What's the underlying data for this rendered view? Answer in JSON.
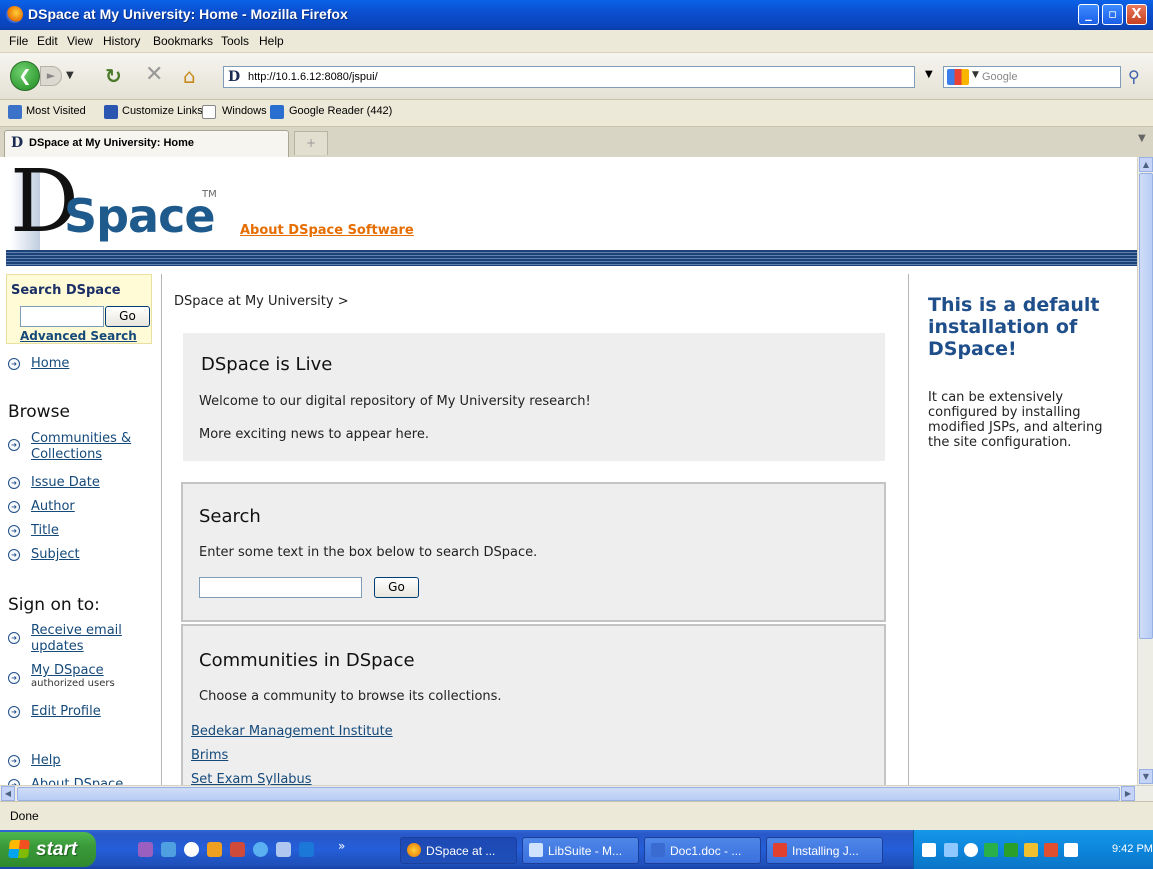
{
  "window": {
    "title": "DSpace at My University: Home - Mozilla Firefox",
    "minimize": "_",
    "maximize": "▫",
    "close": "X"
  },
  "menu": [
    "File",
    "Edit",
    "View",
    "History",
    "Bookmarks",
    "Tools",
    "Help"
  ],
  "nav": {
    "url": "http://10.1.6.12:8080/jspui/",
    "search_engine": "Google"
  },
  "bookmarks": [
    "Most Visited",
    "Customize Links",
    "Windows",
    "Google Reader (442)"
  ],
  "tab": {
    "title": "DSpace at My University: Home"
  },
  "page": {
    "logo_letter": "D",
    "logo_word": "Space",
    "logo_tm": "TM",
    "about_link": "About DSpace Software",
    "left": {
      "search_title": "Search DSpace",
      "go": "Go",
      "advanced": "Advanced Search",
      "home": "Home",
      "browse_heading": "Browse",
      "browse": [
        "Communities & Collections",
        "Issue Date",
        "Author",
        "Title",
        "Subject"
      ],
      "signon_heading": "Sign on to:",
      "receive": "Receive email updates",
      "mydspace": "My DSpace",
      "mydspace_sub": "authorized users",
      "edit_profile": "Edit Profile",
      "help": "Help",
      "about": "About DSpace"
    },
    "breadcrumb": "DSpace at My University >",
    "live": {
      "title": "DSpace is Live",
      "p1": "Welcome to our digital repository of My University research!",
      "p2": "More exciting news to appear here."
    },
    "search": {
      "title": "Search",
      "desc": "Enter some text in the box below to search DSpace.",
      "go": "Go"
    },
    "communities": {
      "title": "Communities in DSpace",
      "desc": "Choose a community to browse its collections.",
      "items": [
        "Bedekar Management Institute",
        "Brims",
        "Set Exam Syllabus"
      ]
    },
    "right": {
      "title": "This is a default installation of DSpace!",
      "text": "It can be extensively configured by installing modified JSPs, and altering the site configuration."
    }
  },
  "status": "Done",
  "taskbar": {
    "start": "start",
    "tasks": [
      "DSpace at ...",
      "LibSuite - M...",
      "Doc1.doc - ...",
      "Installing J..."
    ],
    "clock": "9:42 PM"
  }
}
